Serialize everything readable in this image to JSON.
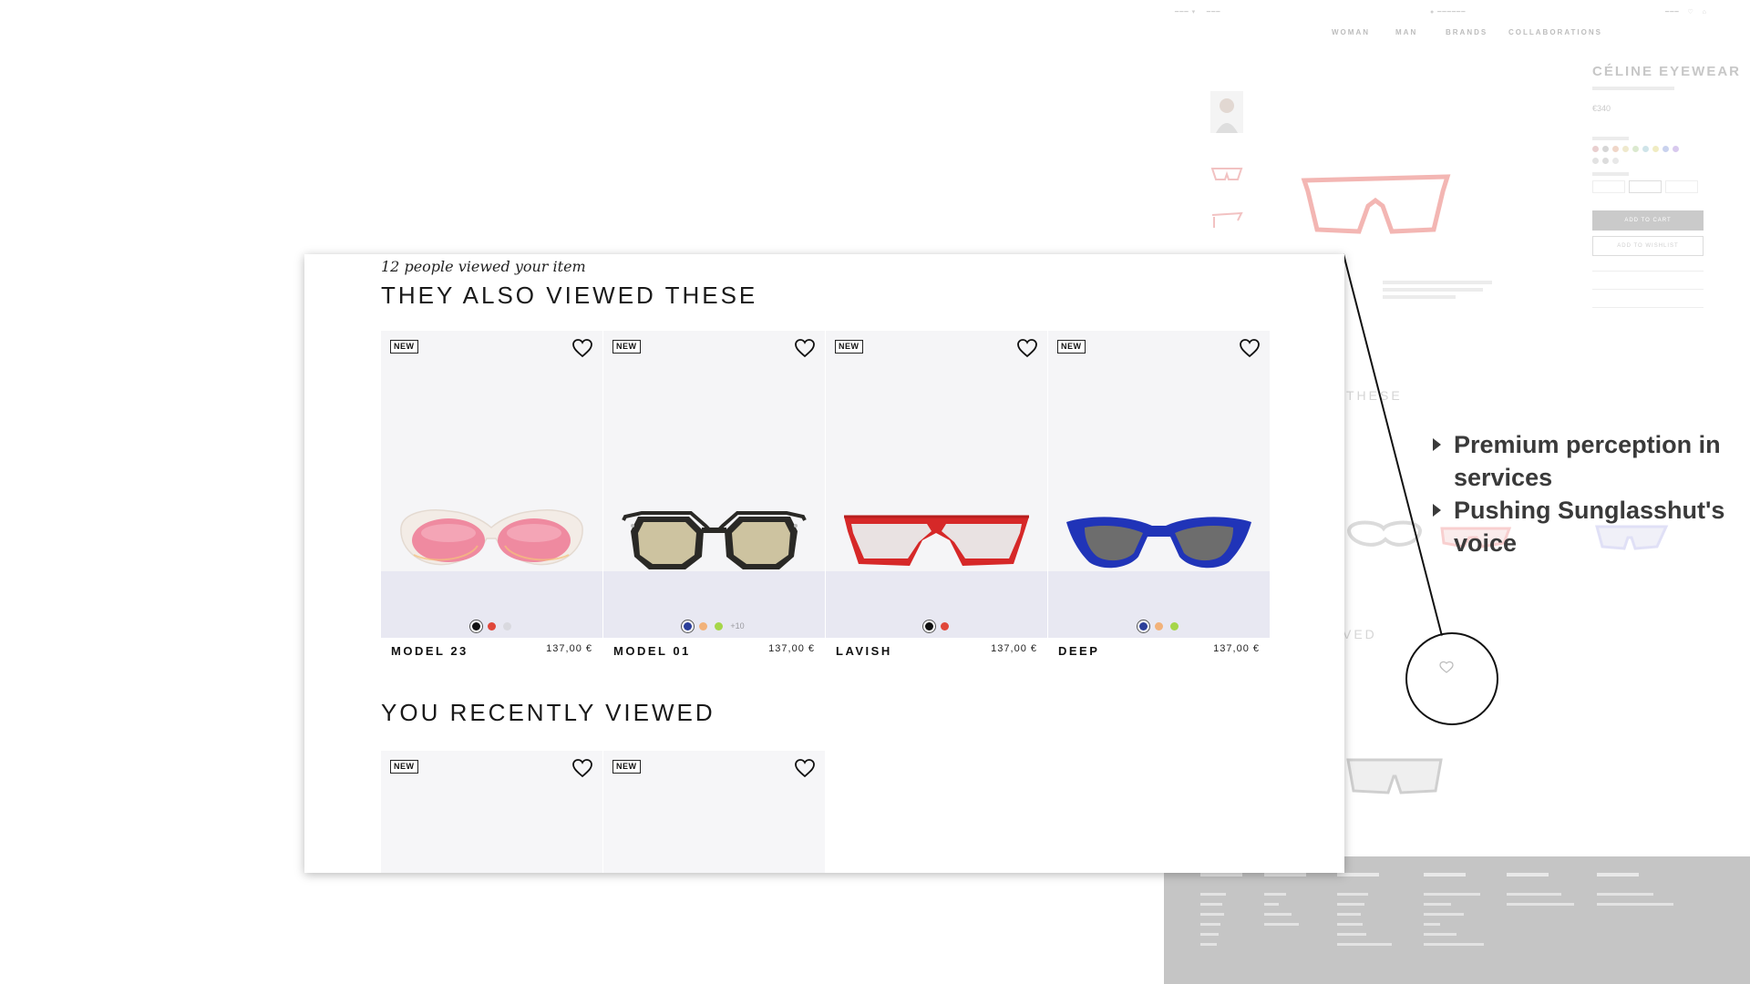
{
  "background_page": {
    "nav": [
      "WOMAN",
      "MAN",
      "BRANDS",
      "COLLABORATIONS"
    ],
    "brand": "CÉLINE EYEWEAR",
    "price": "€340",
    "add_to_cart": "ADD TO CART",
    "add_to_wishlist": "ADD TO WISHLIST",
    "section_heads": [
      "THESE",
      "VED"
    ]
  },
  "callouts": [
    "Premium perception in services",
    "Pushing Sunglasshut's voice"
  ],
  "panel": {
    "subtitle": "12 people viewed your item",
    "also_viewed_title": "THEY ALSO VIEWED THESE",
    "recent_title": "YOU RECENTLY VIEWED",
    "also_viewed": [
      {
        "badge": "NEW",
        "name": "MODEL 23",
        "price": "137,00 €",
        "frame": "#f3ece6",
        "lens": "#ef8aa0",
        "swatches": [
          "#111111",
          "#e0473a",
          "#d9d9df"
        ],
        "more": ""
      },
      {
        "badge": "NEW",
        "name": "MODEL 01",
        "price": "137,00 €",
        "frame": "#2a2926",
        "lens": "#cdc3a0",
        "swatches": [
          "#2c3f9a",
          "#f2b27a",
          "#a6d64a"
        ],
        "more": "+10"
      },
      {
        "badge": "NEW",
        "name": "LAVISH",
        "price": "137,00 €",
        "frame": "#d62828",
        "lens": "#e9e2e2",
        "swatches": [
          "#111111",
          "#e0473a"
        ],
        "more": ""
      },
      {
        "badge": "NEW",
        "name": "DEEP",
        "price": "137,00 €",
        "frame": "#2034b8",
        "lens": "#6d6d6d",
        "swatches": [
          "#2c3f9a",
          "#f2b27a",
          "#a6d64a"
        ],
        "more": ""
      }
    ],
    "recently_viewed": [
      {
        "badge": "NEW"
      },
      {
        "badge": "NEW"
      }
    ]
  }
}
